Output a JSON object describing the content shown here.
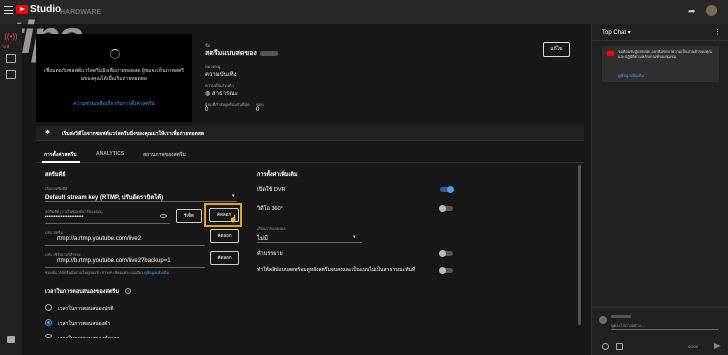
{
  "app": {
    "logo_text": "Studio",
    "watermark": "tips",
    "watermark_sub": "HARDWARE"
  },
  "nav": {
    "live_label": "ไลฟ์"
  },
  "preview": {
    "message": "เชื่อมต่อกับซอฟต์แวร์สตรีมมิ่งเพื่อถ่ายทอดสด ผู้ชมจะเห็นภาพสตรีมของคุณได้เมื่อเริ่มถ่ายทอดสด",
    "help_link": "ความช่วยเหลือเกี่ยวกับการตั้งค่าสตรีม"
  },
  "info": {
    "title_label": "ชื่อ",
    "title_value": "สตรีมแบบสดของ",
    "category_label": "หมวดหมู่",
    "category_value": "ความบันเทิง",
    "privacy_label": "ความเป็นส่วนตัว",
    "privacy_value": "สาธารณะ",
    "viewers_label": "ผู้ชมที่กำลังดูพร้อมกันที่สุด",
    "viewers_value": "0",
    "likes_label": "ชอบ",
    "likes_value": "0",
    "edit_label": "แก้ไข"
  },
  "banner": {
    "text": "เริ่มส่งวิดีโอจากซอฟต์แวร์สตรีมมิ่งของคุณมาให้เราเพื่อถ่ายทอดสด"
  },
  "tabs": [
    {
      "label": "การตั้งค่าสตรีม"
    },
    {
      "label": "ANALYTICS"
    },
    {
      "label": "สถานภาพของสตรีม"
    }
  ],
  "stream_key": {
    "section_title": "สตรีมคีย์",
    "select_label": "เลือกสตรีมคีย์",
    "select_value": "Default stream key (RTMP, ปรับอัตราบิตได้)",
    "key_label": "สตรีมคีย์ (วางในซอฟต์แวร์ของคุณ)",
    "key_value": "••••••••••••••••••••••",
    "reset_label": "รีเซ็ต",
    "copy_label": "คัดลอก",
    "url_label": "URL สตรีม",
    "url_value": "rtmp://a.rtmp.youtube.com/live2",
    "backup_label": "URL เซิร์ฟเวอร์สำรอง",
    "backup_value": "rtmp://b.rtmp.youtube.com/live2?backup=1",
    "hint": "ซอฟต์แวร์สตรีมมิ่งส่วนใหญ่รองรับ RTMP เพียงแค่ระบบเดียว",
    "hint_link": "ดูข้อมูลเพิ่มเติม"
  },
  "latency": {
    "title": "เวลาในการตอบสนองของสตรีม",
    "options": [
      "เวลาในการตอบสนองปกติ",
      "เวลาในการตอบสนองต่ำ",
      "เวลาในการตอบสนองต่ำมาก"
    ],
    "selected_index": 1
  },
  "extra": {
    "title": "การตั้งค่าเพิ่มเติม",
    "dvr_label": "เปิดใช้ DVR",
    "dvr_on": true,
    "v360_label": "วิดีโอ 360°",
    "v360_on": false,
    "delay_label": "เลื่อนการแสดงผล",
    "delay_value": "ไม่มี",
    "caption_label": "คำบรรยาย",
    "caption_on": false,
    "clip_label": "ทำให้คลิปแบบสดพร้อมดูหลังสตรีมจบลงและเป็นแบบไม่เป็นสาธารณะทันที",
    "clip_on": false
  },
  "chat": {
    "title": "Top Chat",
    "notice": "ขอต้อนรับสู่แชทสด! อย่าลืมรักษาความเป็นส่วนตัวของคุณและปฏิบัติตามหลักเกณฑ์ของชุมชน",
    "notice_link": "ดูข้อมูลเพิ่มเติม",
    "input_placeholder": "พูดอะไรบางอย่าง...",
    "counter": "0/200"
  },
  "colors": {
    "accent": "#3ea6ff",
    "highlight": "#e3a12a",
    "brand": "#ff0000"
  }
}
